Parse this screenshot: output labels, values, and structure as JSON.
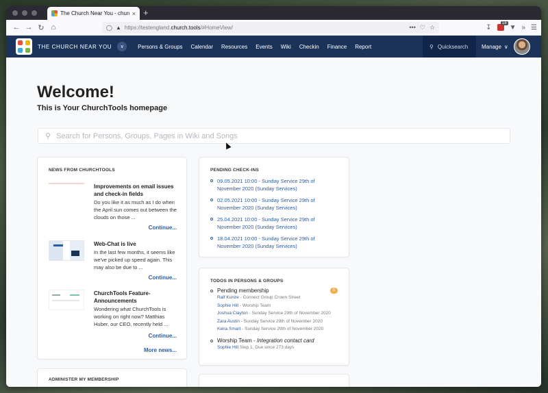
{
  "browser": {
    "tab_title": "The Church Near You - churchT",
    "tab_close": "×",
    "new_tab": "+",
    "url_prefix": "https://testengland.",
    "url_domain": "church.tools",
    "url_suffix": "/#HomeView/",
    "url_more": "•••",
    "ext_badge": "18"
  },
  "header": {
    "church_name": "THE CHURCH NEAR YOU",
    "nav": [
      "Persons & Groups",
      "Calendar",
      "Resources",
      "Events",
      "Wiki",
      "Checkin",
      "Finance",
      "Report"
    ],
    "quicksearch": "Quicksearch",
    "manage": "Manage"
  },
  "page": {
    "welcome": "Welcome!",
    "subtitle": "This is Your ChurchTools homepage",
    "search_placeholder": "Search for Persons, Groups, Pages in Wiki and Songs"
  },
  "news": {
    "title": "NEWS FROM CHURCHTOOLS",
    "items": [
      {
        "headline": "Improvements on email issues and check-in fields",
        "body": "Do you like it as much as I do when the April sun comes out between the clouds on those ...",
        "link": "Continue..."
      },
      {
        "headline": "Web-Chat is live",
        "body": "In the last few months, it seems like we've picked up speed again. This may also be due to ...",
        "link": "Continue..."
      },
      {
        "headline": "ChurchTools Feature-Announcements",
        "body": "Wondering what ChurchTools is working on right now? Matthias Huber, our CEO, recently held ...",
        "link": "Continue..."
      }
    ],
    "more": "More news..."
  },
  "checkins": {
    "title": "PENDING CHECK-INS",
    "items": [
      "09.05.2021 10:00 - Sunday Service 29th of November 2020 (Sunday Services)",
      "02.05.2021 10:00 - Sunday Service 29th of November 2020 (Sunday Services)",
      "25.04.2021 10:00 - Sunday Service 29th of November 2020 (Sunday Services)",
      "18.04.2021 10:00 - Sunday Service 29th of November 2020 (Sunday Services)"
    ]
  },
  "todos": {
    "title": "TODOS IN PERSONS & GROUPS",
    "groups": [
      {
        "name": "Pending membership",
        "badge": "5",
        "rows": [
          {
            "who": "Ralf Kunze",
            "what": " - Connect Group Crown Street"
          },
          {
            "who": "Sophie Hill",
            "what": " - Worship Team"
          },
          {
            "who": "Joshua Clayton",
            "what": " - Sunday Service 29th of November 2020"
          },
          {
            "who": "Zara Austin",
            "what": " - Sunday Service 29th of November 2020"
          },
          {
            "who": "Keira Smart",
            "what": " - Sunday Service 29th of November 2020"
          }
        ]
      },
      {
        "name_prefix": "Worship Team - ",
        "name_italic": "Integration contact card",
        "rows": [
          {
            "who": "Sophie Hill",
            "what": " Step 1, Due since 273 days"
          }
        ]
      }
    ]
  },
  "membership": {
    "title": "ADMINISTER MY MEMBERSHIP"
  }
}
